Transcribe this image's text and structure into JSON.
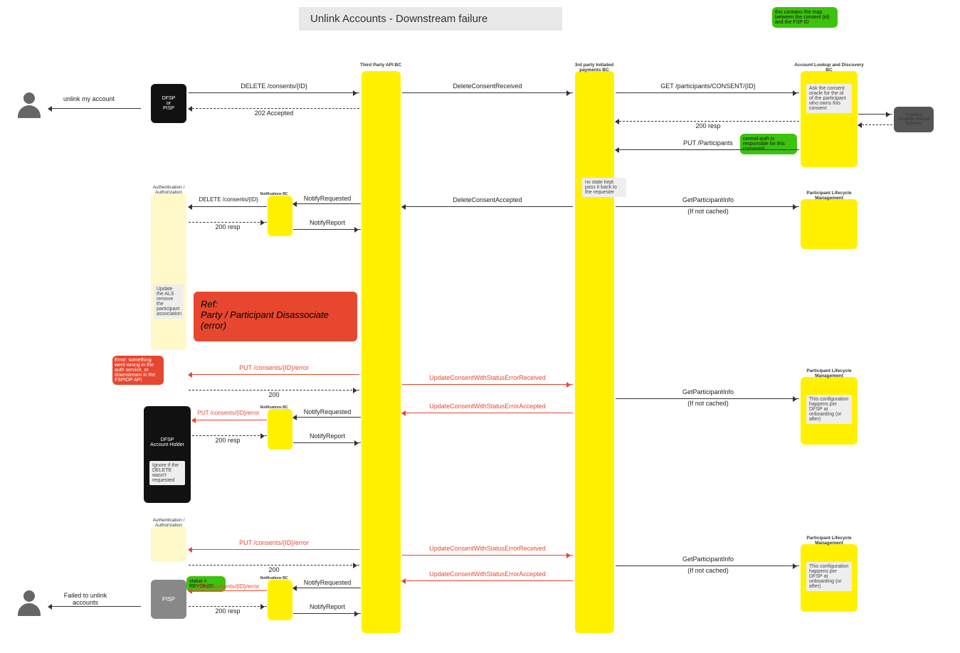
{
  "title": "Unlink Accounts - Downstream failure",
  "top_note": "this contains the map between the consent (id) and the FSP ID",
  "actors": {
    "dfsp_pisp": "DFSP\nor\nPISP",
    "third_party_api": "Third Party API BC",
    "tpip_bc": "3rd party Initiated payments BC",
    "account_lookup": "Account Lookup and Discovery BC",
    "oracle": "Oracle(s) CouldBe internal Systems",
    "auth": "Authentication / Authorization",
    "notif": "Notifications BC",
    "dfsp_acct": "DFSP\nAccount Holder",
    "pisp": "PISP",
    "plm": "Participant Lifecycle Management"
  },
  "user_msgs": {
    "unlink": "unlink my account",
    "failed": "Failed to unlink accounts"
  },
  "msgs": {
    "delete_consents": "DELETE /consents/{ID}",
    "accepted_202": "202 Accepted",
    "delete_received": "DeleteConsentReceived",
    "delete_accepted": "DeleteConsentAccepted",
    "get_participants": "GET /participants/CONSENT/{ID}",
    "resp_200": "200 resp",
    "resp_200p": "200",
    "put_participants": "PUT /Participants",
    "get_pinfo": "GetParticipantInfo",
    "if_not_cached": "(If not cached)",
    "notify_req": "NotifyRequested",
    "notify_rep": "NotifyReport",
    "put_error": "PUT /consents/{ID}/error",
    "upd_err_recv": "UpdateConsentWithStatusErrorReceived",
    "upd_err_acc": "UpdateConsentWithStatusErrorAccepted"
  },
  "notes": {
    "ask_oracle": "Ask the consent oracle for the id of the participant who owns this consent",
    "central_auth": "central-auth is responsible for this consentId",
    "no_state": "no state kept pass it back to the requester",
    "update_als": "Update the ALS remove the participant association",
    "error_auth": "Error: something went wrong in the auth service, or downstream in the FSPIOP API",
    "ignore_delete": "Ignore if the DELETE wasn't requested",
    "config_dfsp": "This configuration happens per DFSP at onboarding (or after)",
    "status_revoked": "status = REVOKED"
  },
  "ref_box": "Ref:\nParty / Participant Disassociate (error)"
}
